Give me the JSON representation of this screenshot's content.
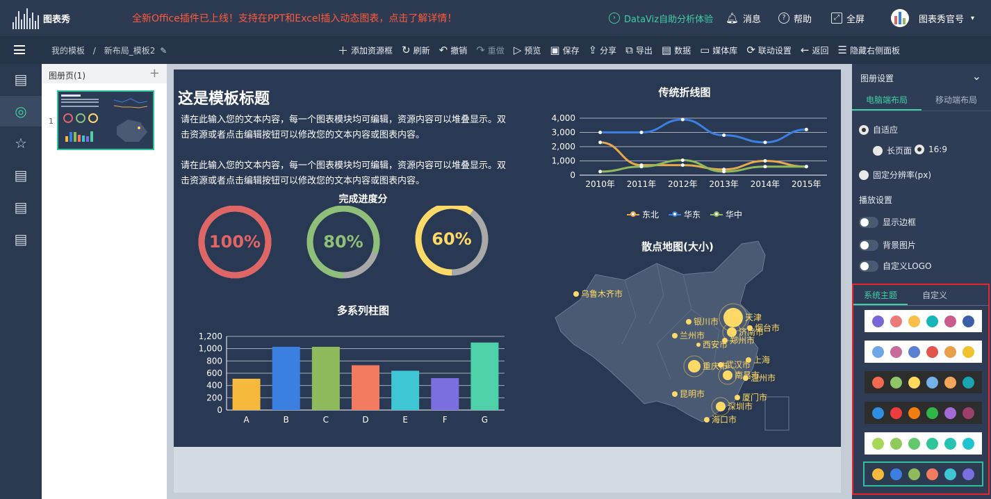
{
  "top": {
    "logo_text": "图表秀",
    "promo": "全新Office插件已上线！支持在PPT和Excel插入动态图表，点击了解详情！",
    "dataviz": "DataViz自助分析体验",
    "message": "消息",
    "help": "帮助",
    "fullscreen": "全屏",
    "account": "图表秀官号"
  },
  "toolbar": {
    "crumb_root": "我的模板",
    "crumb_sep": "/",
    "crumb_current": "新布局_模板2",
    "tools": [
      "添加资源框",
      "刷新",
      "撤销",
      "重做",
      "预览",
      "保存",
      "分享",
      "导出",
      "数据",
      "媒体库",
      "联动设置",
      "返回",
      "隐藏右侧面板"
    ]
  },
  "pages_panel": {
    "title": "图册页(1)",
    "add": "+",
    "page_number": "1"
  },
  "slide": {
    "title": "这是模板标题",
    "text1": "请在此输入您的文本内容，每一个图表模块均可编辑，资源内容可以堆叠显示。双击资源或者点击编辑按钮可以修改您的文本内容或图表内容。",
    "text2": "请在此输入您的文本内容，每一个图表模块均可编辑，资源内容可以堆叠显示。双击资源或者点击编辑按钮可以修改您的文本内容或图表内容。",
    "progress_title": "完成进度分",
    "bar_title": "多系列柱图",
    "line_title": "传统折线图",
    "map_title": "散点地图(大小)"
  },
  "progress": [
    {
      "label": "100%",
      "value": 1.0,
      "color": "#e06666"
    },
    {
      "label": "80%",
      "value": 0.8,
      "color": "#8fc07a"
    },
    {
      "label": "60%",
      "value": 0.6,
      "color": "#ffd966"
    }
  ],
  "chart_data": [
    {
      "type": "bar",
      "title": "多系列柱图",
      "categories": [
        "A",
        "B",
        "C",
        "D",
        "E",
        "F",
        "G"
      ],
      "values": [
        510,
        1030,
        1030,
        730,
        640,
        520,
        1100
      ],
      "colors": [
        "#f6b93b",
        "#3b7fe0",
        "#8fbb5c",
        "#f27b60",
        "#3fc6d4",
        "#7b6fe0",
        "#4ed0a8"
      ],
      "ylim": [
        0,
        1200
      ],
      "yticks": [
        "0",
        "200",
        "400",
        "600",
        "800",
        "1,000",
        "1,200"
      ]
    },
    {
      "type": "line",
      "title": "传统折线图",
      "categories": [
        "2010年",
        "2011年",
        "2012年",
        "2013年",
        "2014年",
        "2015年"
      ],
      "ylim": [
        0,
        4000
      ],
      "yticks": [
        "0",
        "1,000",
        "2,000",
        "3,000",
        "4,000"
      ],
      "series": [
        {
          "name": "东北",
          "color": "#e8a94b",
          "values": [
            2300,
            700,
            700,
            400,
            1000,
            600
          ]
        },
        {
          "name": "华东",
          "color": "#3b7fe0",
          "values": [
            3000,
            3000,
            3900,
            2800,
            2300,
            3200
          ]
        },
        {
          "name": "华中",
          "color": "#8fbb5c",
          "values": [
            250,
            600,
            1050,
            250,
            600,
            600
          ]
        }
      ]
    }
  ],
  "map_cities": [
    "乌鲁木齐市",
    "银川市",
    "兰州市",
    "西安市",
    "天津",
    "烟台市",
    "济南市",
    "郑州市",
    "上海",
    "重庆市",
    "武汉市",
    "南昌市",
    "温州市",
    "昆明市",
    "厦门市",
    "深圳市",
    "海口市"
  ],
  "right_panel": {
    "title": "图册设置",
    "tab_pc": "电脑端布局",
    "tab_mobile": "移动端布局",
    "adaptive": "自适应",
    "long_page": "长页面",
    "ratio": "16:9",
    "fixed": "固定分辨率(px)",
    "play_title": "播放设置",
    "show_border": "显示边框",
    "bg_image": "背景图片",
    "custom_logo": "自定义LOGO",
    "theme_tab_system": "系统主题",
    "theme_tab_custom": "自定义"
  },
  "themes": [
    {
      "bg": "#ffffff",
      "colors": [
        "#7b68d6",
        "#ee7a78",
        "#f8c04a",
        "#17b5b8",
        "#c95c8c",
        "#3b5ea8"
      ]
    },
    {
      "bg": "#ffffff",
      "colors": [
        "#6ea6e8",
        "#c86a9a",
        "#5b7fd1",
        "#e0554c",
        "#e8a04a",
        "#f2c12e"
      ]
    },
    {
      "bg": "#2d2d2d",
      "colors": [
        "#f26b4f",
        "#8fc46a",
        "#ffd95a",
        "#75b0e6",
        "#f5a65b",
        "#1aa3b5"
      ]
    },
    {
      "bg": "#2d2d2d",
      "colors": [
        "#2e8ee0",
        "#ef3b3b",
        "#f57c0f",
        "#2fb548",
        "#a36ad6",
        "#9c3f6a"
      ]
    },
    {
      "bg": "#ffffff",
      "colors": [
        "#a6d858",
        "#8fca5a",
        "#62c86b",
        "#2fc49a",
        "#26c3b3",
        "#1ec5d1"
      ]
    },
    {
      "bg": "#2d3b52",
      "colors": [
        "#f6b93b",
        "#3b7fe0",
        "#8fbb5c",
        "#f27b60",
        "#3fc6d4",
        "#7b6fe0"
      ]
    }
  ]
}
